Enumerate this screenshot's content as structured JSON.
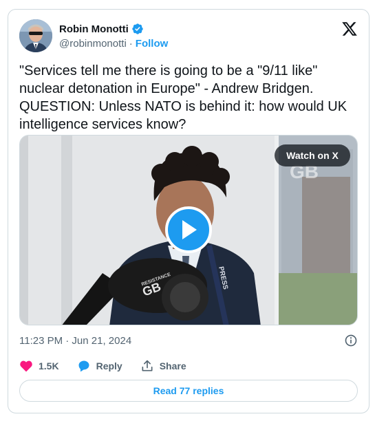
{
  "author": {
    "name": "Robin Monotti",
    "handle": "@robinmonotti",
    "separator": "·",
    "follow_label": "Follow"
  },
  "tweet": {
    "text": "\"Services tell me there is going to be a \"9/11 like\" nuclear detonation in Europe\" - Andrew Bridgen. QUESTION: Unless NATO is behind it: how would UK intelligence services know?"
  },
  "media": {
    "watch_label": "Watch on X",
    "watermark": "GB",
    "mic_logo_top": "RESISTANCE",
    "mic_logo": "GB",
    "lanyard_text": "PRESS"
  },
  "timestamp": "11:23 PM · Jun 21, 2024",
  "actions": {
    "like_count": "1.5K",
    "reply_label": "Reply",
    "share_label": "Share"
  },
  "read_replies_label": "Read 77 replies",
  "colors": {
    "accent": "#1d9bf0",
    "like": "#f91880",
    "text": "#0f1419",
    "secondary": "#536471",
    "border": "#cfd9de"
  },
  "icons": [
    "verified-badge-icon",
    "x-logo-icon",
    "play-icon",
    "info-icon",
    "heart-icon",
    "reply-bubble-icon",
    "share-icon"
  ]
}
